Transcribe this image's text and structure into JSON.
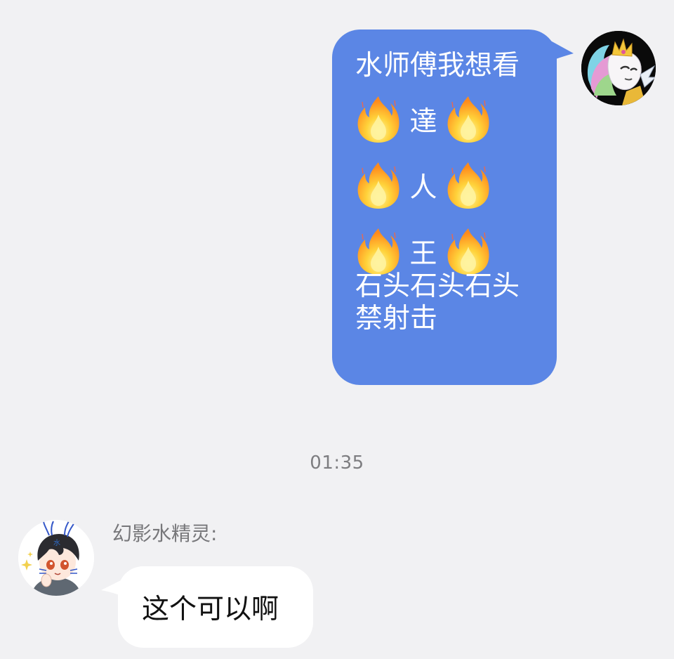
{
  "outgoing": {
    "line1": "水师傅我想看",
    "fire_rows": [
      {
        "char": "達"
      },
      {
        "char": "人"
      },
      {
        "char": "王"
      }
    ],
    "line_stone": "石头石头石头",
    "line_ban": "禁射击",
    "bubble_color": "#5b86e5",
    "avatar_icon": "pony-princess-avatar-icon"
  },
  "timestamp": "01:35",
  "incoming": {
    "sender": "幻影水精灵:",
    "text": "这个可以啊",
    "bubble_color": "#ffffff",
    "avatar_icon": "anime-boy-avatar-icon"
  },
  "background_color": "#f1f1f3"
}
